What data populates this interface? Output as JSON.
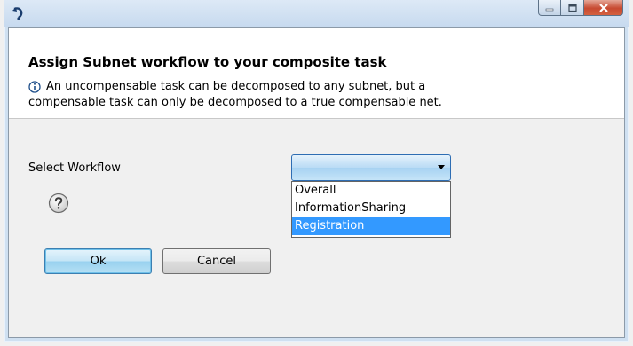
{
  "window": {
    "app_icon": "undo-arrow-icon",
    "controls": [
      "minimize-icon",
      "maximize-icon",
      "close-icon"
    ]
  },
  "dialog": {
    "title": "Assign Subnet workflow to your composite task",
    "info_icon": "info-icon",
    "info_line1": "An uncompensable task can be decomposed to any subnet, but a",
    "info_line2": "compensable task can only be decomposed to a true compensable net."
  },
  "form": {
    "select_label": "Select Workflow",
    "combo_value": "",
    "options": [
      "Overall",
      "InformationSharing",
      "Registration"
    ],
    "highlighted_option": "Registration",
    "help_icon": "question-mark-icon"
  },
  "buttons": {
    "ok_label": "Ok",
    "cancel_label": "Cancel"
  },
  "colors": {
    "highlight": "#3399ff",
    "close_button": "#c74a31",
    "titlebar": "#cfe0f1"
  }
}
